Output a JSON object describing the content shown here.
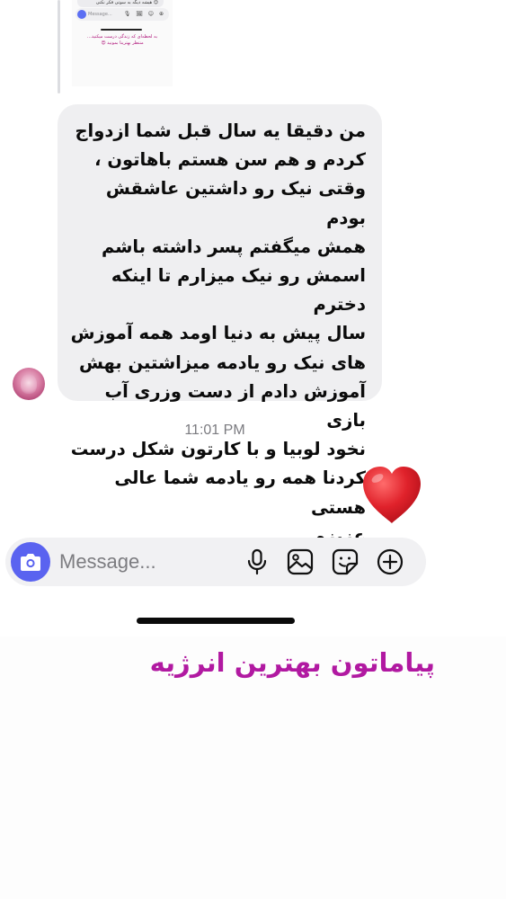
{
  "reply_preview": {
    "top_message": "هیشه دیگه به سوتی فکر نکنی 😉",
    "composer_placeholder": "Message...",
    "composer_icons": "🎙 🖼 ☺ ⊕",
    "caption": "به لحظه‌ای که زندگی درست میکنید… منتظر بهترینا بمونید 😍"
  },
  "message": {
    "text": "من دقیقا یه سال قبل شما ازدواج\nکردم و هم سن هستم باهاتون ،\nوقتی نیک رو داشتین عاشقش بودم\nهمش میگفتم پسر داشته باشم\nاسمش رو نیک میزارم تا اینکه دخترم\nسال پیش به دنیا اومد همه آموزش\nهای نیک رو یادمه میزاشتین بهش\nآموزش دادم از دست وزری آب بازی\nنخود لوبیا و با کارتون شکل درست\nکردنا همه رو یادمه شما عالی هستی\nعزیزم",
    "avatar_icon": "avatar-profile-photo"
  },
  "timestamp": "11:01 PM",
  "reaction": {
    "icon": "red-heart-icon",
    "color": "#e0222b"
  },
  "composer": {
    "placeholder": "Message...",
    "camera_icon": "camera-icon",
    "mic_icon": "microphone-icon",
    "gallery_icon": "gallery-icon",
    "sticker_icon": "sticker-icon",
    "plus_icon": "plus-icon",
    "accent_color": "#5a63f0"
  },
  "caption": "پیاماتون بهترین انرژیه",
  "colors": {
    "bubble_bg": "#efeff1",
    "caption": "#b119a1",
    "timestamp": "#7b7b80"
  }
}
